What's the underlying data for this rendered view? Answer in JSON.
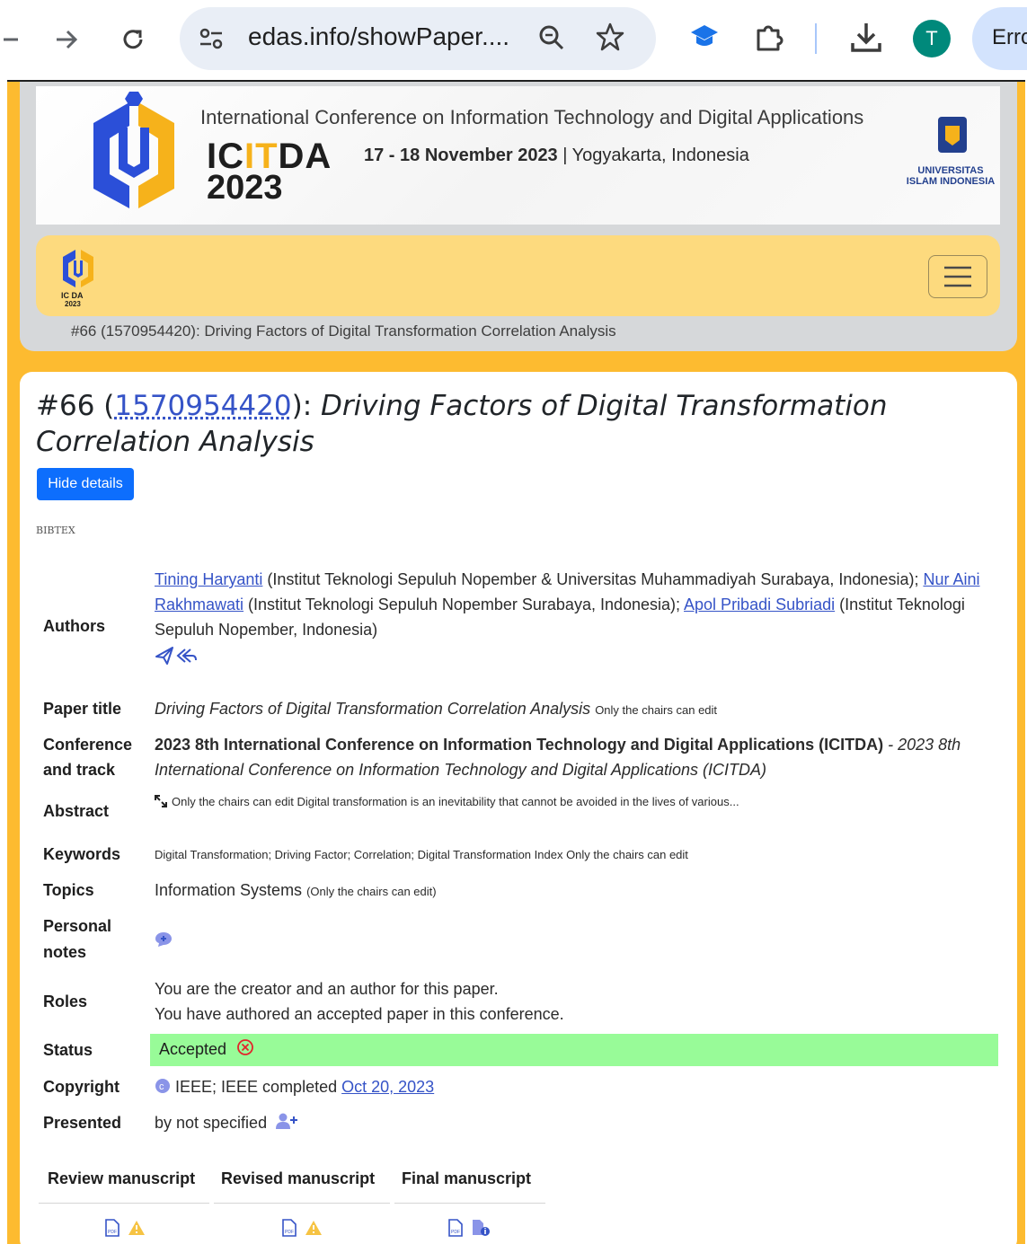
{
  "browser": {
    "url": "edas.info/showPaper....",
    "profile_initial": "T",
    "error_pill": "Erro"
  },
  "banner": {
    "tagline": "International Conference on Information Technology and Digital Applications",
    "acronym_pre": "IC",
    "acronym_hl": "IT",
    "acronym_post": "DA",
    "year": "2023",
    "dates": "17 - 18 November 2023",
    "location": "| Yogyakarta, Indonesia",
    "university": "UNIVERSITAS ISLAM INDONESIA",
    "small_logo_text": "IC DA 2023"
  },
  "breadcrumb": "#66 (1570954420): Driving Factors of Digital Transformation Correlation Analysis",
  "paper": {
    "number": "#66 (",
    "edas_id": "1570954420",
    "title_sep": "): ",
    "title": "Driving Factors of Digital Transformation Correlation Analysis",
    "hide_details_label": "Hide details",
    "bibtex_label": "BIBTEX"
  },
  "fields": {
    "authors_label": "Authors",
    "author1": "Tining Haryanti",
    "author1_aff": " (Institut Teknologi Sepuluh Nopember & Universitas Muhammadiyah Surabaya, Indonesia); ",
    "author2": "Nur Aini Rakhmawati",
    "author2_aff": " (Institut Teknologi Sepuluh Nopember Surabaya, Indonesia); ",
    "author3": "Apol Pribadi Subriadi",
    "author3_aff": " (Institut Teknologi Sepuluh Nopember, Indonesia)",
    "paper_title_label": "Paper title",
    "paper_title": "Driving Factors of Digital Transformation Correlation Analysis",
    "chairs_only": "Only the chairs can edit",
    "conference_label_1": "Conference",
    "conference_label_2": "and track",
    "conference": "2023 8th International Conference on Information Technology and Digital Applications (ICITDA)",
    "track": " - 2023 8th International Conference on Information Technology and Digital Applications (ICITDA)",
    "abstract_label": "Abstract",
    "abstract": "Only the chairs can edit Digital transformation is an inevitability that cannot be avoided in the lives of various...",
    "keywords_label": "Keywords",
    "keywords": "Digital Transformation; Driving Factor; Correlation; Digital Transformation Index Only the chairs can edit",
    "topics_label": "Topics",
    "topics": "Information Systems",
    "topics_note": "(Only the chairs can edit)",
    "notes_label_1": "Personal",
    "notes_label_2": "notes",
    "roles_label": "Roles",
    "role1": "You are the creator and an author for this paper.",
    "role2": "You have authored an accepted paper in this conference.",
    "status_label": "Status",
    "status": "Accepted",
    "copyright_label": "Copyright",
    "copyright": "IEEE; IEEE completed",
    "copyright_date": "Oct 20, 2023",
    "presented_label": "Presented",
    "presented": "by not specified"
  },
  "manuscripts": {
    "review": "Review manuscript",
    "revised": "Revised manuscript",
    "final": "Final manuscript"
  },
  "colors": {
    "frame": "#fdbb30",
    "navbar": "#fdda7e",
    "status_bg": "#98fb98",
    "link": "#3553c7",
    "button": "#0d6efd"
  }
}
